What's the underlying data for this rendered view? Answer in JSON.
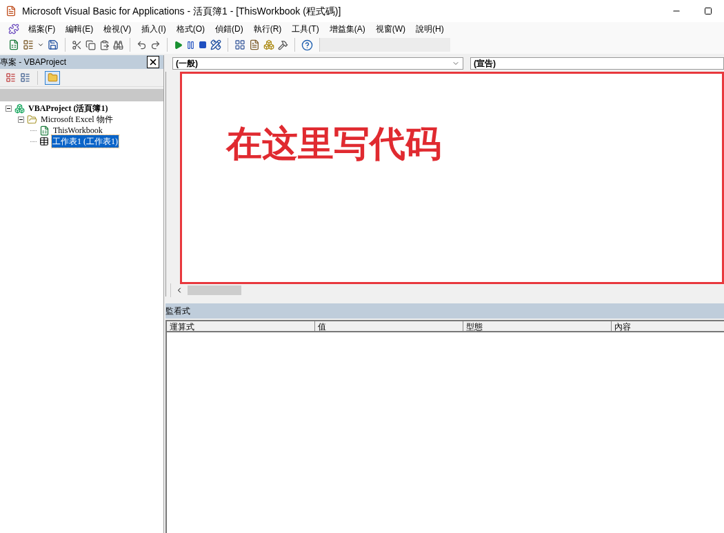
{
  "window": {
    "title": "Microsoft Visual Basic for Applications - 活頁簿1 - [ThisWorkbook (程式碼)]"
  },
  "menu": [
    "檔案(F)",
    "編輯(E)",
    "檢視(V)",
    "插入(I)",
    "格式(O)",
    "偵錯(D)",
    "執行(R)",
    "工具(T)",
    "增益集(A)",
    "視窗(W)",
    "說明(H)"
  ],
  "project_pane": {
    "title": "專案 - VBAProject",
    "tree": [
      {
        "label": "VBAProject (活頁簿1)",
        "kind": "project",
        "bold": true,
        "expanded": true,
        "selected": false,
        "children": [
          {
            "label": "Microsoft Excel 物件",
            "kind": "folder",
            "bold": false,
            "expanded": true,
            "selected": false,
            "children": [
              {
                "label": "ThisWorkbook",
                "kind": "workbook",
                "bold": false,
                "selected": false
              },
              {
                "label": "工作表1 (工作表1)",
                "kind": "sheet",
                "bold": false,
                "selected": true
              }
            ]
          }
        ]
      }
    ]
  },
  "code_pane": {
    "object_dropdown": "(一般)",
    "procedure_dropdown": "(宣告)",
    "annotation": "在这里写代码"
  },
  "watch_pane": {
    "title": "監看式",
    "columns": [
      "運算式",
      "值",
      "型態",
      "內容"
    ]
  }
}
